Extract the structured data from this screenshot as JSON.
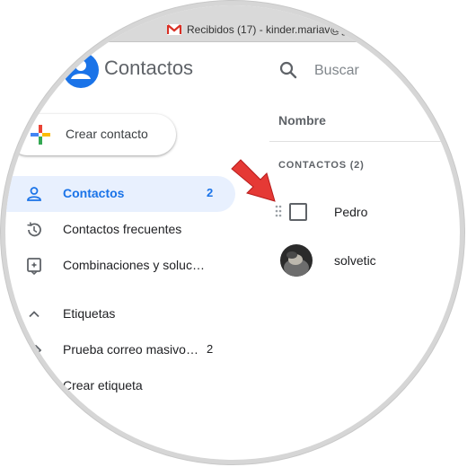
{
  "browser": {
    "tab_title": "Recibidos (17) - kinder.mariav@g"
  },
  "app": {
    "title": "Contactos"
  },
  "search": {
    "placeholder": "Buscar"
  },
  "create_button": {
    "label": "Crear contacto"
  },
  "sidebar": {
    "items": [
      {
        "label": "Contactos",
        "count": "2",
        "icon": "person-icon",
        "active": true
      },
      {
        "label": "Contactos frecuentes",
        "icon": "history-icon"
      },
      {
        "label": "Combinaciones y soluc…",
        "icon": "merge-icon"
      }
    ],
    "labels_section": {
      "label": "Etiquetas",
      "icon": "chevron-up-icon"
    },
    "labels": [
      {
        "label": "Prueba correo masivo…",
        "count": "2",
        "icon": "label-icon"
      }
    ],
    "create_label": {
      "label": "Crear etiqueta",
      "icon": "add-icon"
    }
  },
  "list": {
    "column_header": "Nombre",
    "section_heading": "CONTACTOS (2)",
    "contacts": [
      {
        "name": "Pedro",
        "avatar": "checkbox"
      },
      {
        "name": "solvetic",
        "avatar": "photo"
      }
    ]
  },
  "colors": {
    "accent": "#1a73e8",
    "active_bg": "#e8f0fe",
    "annotation_arrow": "#e53935"
  }
}
